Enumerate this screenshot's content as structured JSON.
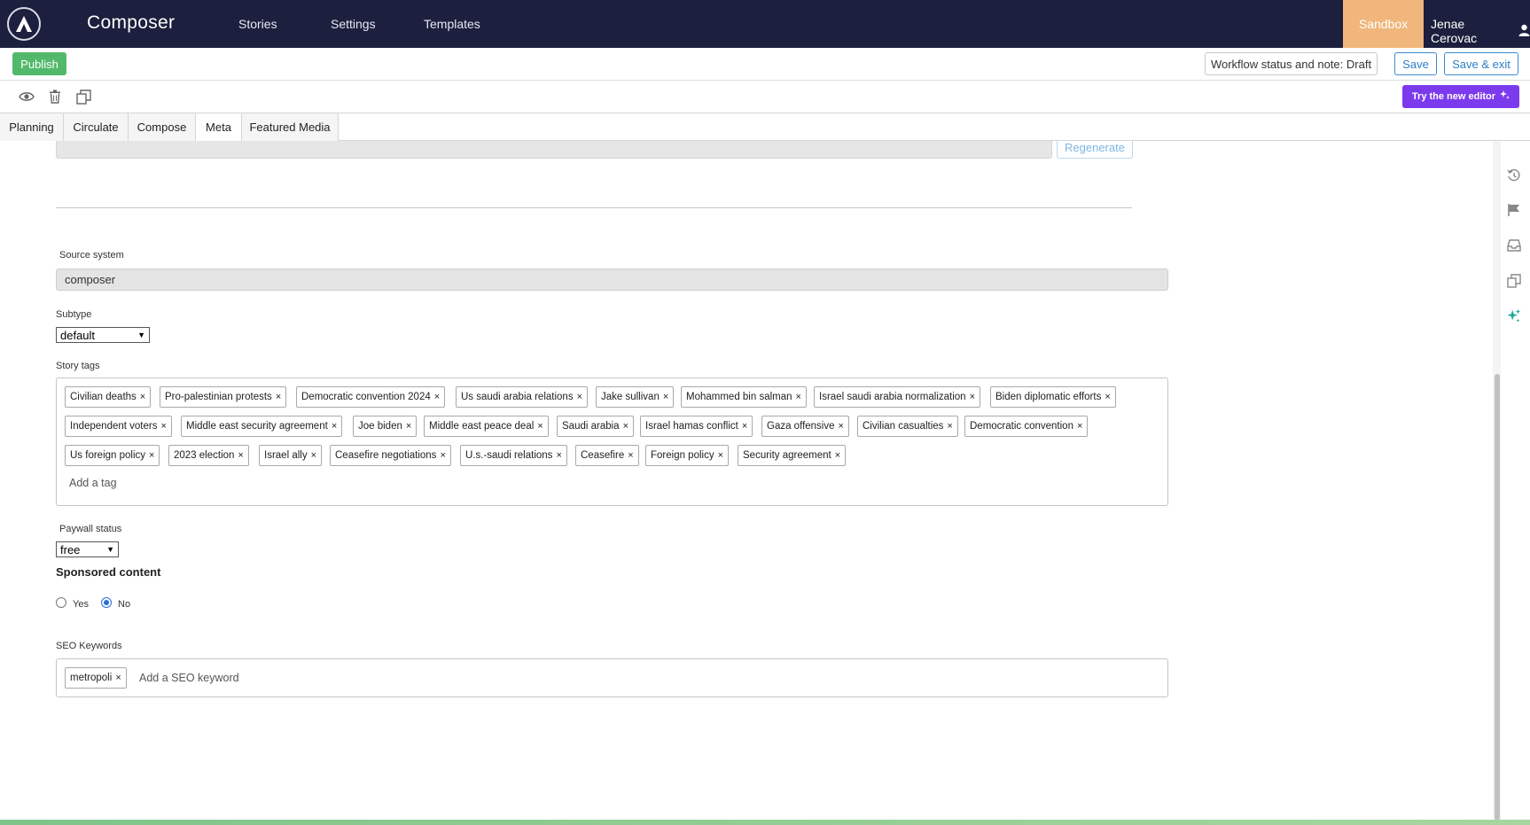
{
  "app": {
    "title": "Composer",
    "nav": [
      "Stories",
      "Settings",
      "Templates"
    ],
    "environment": "Sandbox",
    "user": "Jenae Cerovac"
  },
  "toolbar": {
    "publish_label": "Publish",
    "workflow_label": "Workflow status and note: Draft",
    "save_label": "Save",
    "save_exit_label": "Save & exit",
    "try_editor_label": "Try the new editor"
  },
  "tabs": [
    {
      "label": "Planning",
      "active": false
    },
    {
      "label": "Circulate",
      "active": false
    },
    {
      "label": "Compose",
      "active": false
    },
    {
      "label": "Meta",
      "active": true
    },
    {
      "label": "Featured Media",
      "active": false
    }
  ],
  "meta": {
    "regenerate_label": "Regenerate",
    "source_system": {
      "label": "Source system",
      "value": "composer"
    },
    "subtype": {
      "label": "Subtype",
      "value": "default"
    },
    "story_tags": {
      "label": "Story tags",
      "placeholder": "Add a tag",
      "tags": [
        "Civilian deaths",
        "Pro-palestinian protests",
        "Democratic convention 2024",
        "Us saudi arabia relations",
        "Jake sullivan",
        "Mohammed bin salman",
        "Israel saudi arabia normalization",
        "Biden diplomatic efforts",
        "Independent voters",
        "Middle east security agreement",
        "Joe biden",
        "Middle east peace deal",
        "Saudi arabia",
        "Israel hamas conflict",
        "Gaza offensive",
        "Civilian casualties",
        "Democratic convention",
        "Us foreign policy",
        "2023 election",
        "Israel ally",
        "Ceasefire negotiations",
        "U.s.-saudi relations",
        "Ceasefire",
        "Foreign policy",
        "Security agreement"
      ]
    },
    "paywall_status": {
      "label": "Paywall status",
      "value": "free"
    },
    "sponsored_content": {
      "label": "Sponsored content",
      "options": [
        "Yes",
        "No"
      ],
      "selected": "No"
    },
    "seo_keywords": {
      "label": "SEO Keywords",
      "placeholder": "Add a SEO keyword",
      "keywords": [
        "metropoli"
      ]
    }
  },
  "colors": {
    "navbar": "#1c1f3d",
    "sandbox": "#f0b67b",
    "publish": "#52b96b",
    "try_editor": "#7c3aed",
    "link_blue": "#2f7fc9"
  }
}
